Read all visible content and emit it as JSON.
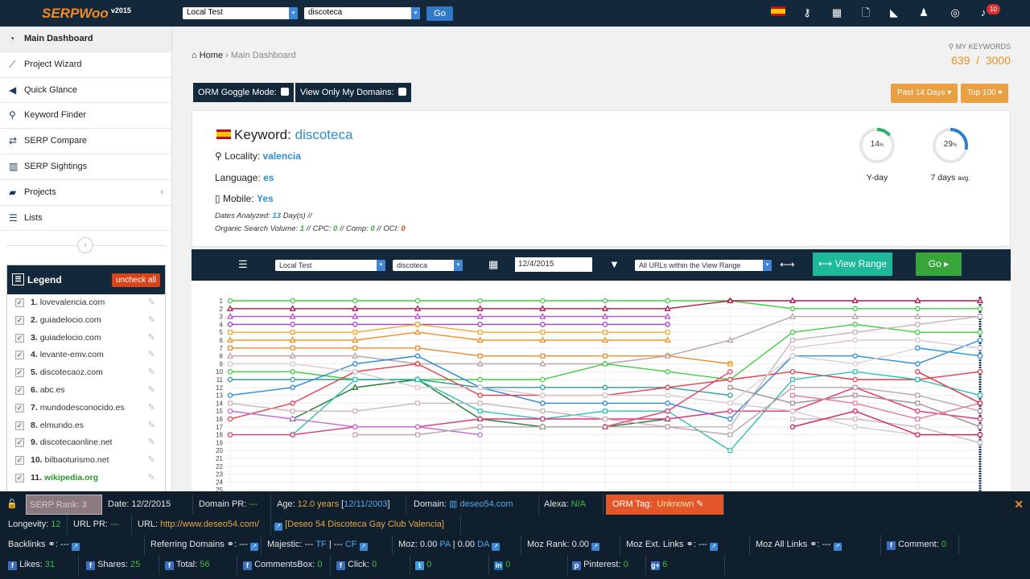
{
  "app": {
    "logo": "SERPWoo",
    "version": "v2015"
  },
  "topbar": {
    "project_select": "Local Test",
    "keyword_select": "discoteca",
    "go_label": "Go",
    "notifications_count": "10",
    "icons": [
      "spain-flag-icon",
      "key-icon",
      "table-icon",
      "pdf-icon",
      "area-chart-icon",
      "users-icon",
      "lifebuoy-icon",
      "bell-icon"
    ]
  },
  "sidebar": {
    "items": [
      {
        "label": "Main Dashboard",
        "icon": "dashboard-icon"
      },
      {
        "label": "Project Wizard",
        "icon": "magic-wand-icon"
      },
      {
        "label": "Quick Glance",
        "icon": "bullhorn-icon"
      },
      {
        "label": "Keyword Finder",
        "icon": "search-icon"
      },
      {
        "label": "SERP Compare",
        "icon": "exchange-icon"
      },
      {
        "label": "SERP Sightings",
        "icon": "bar-chart-icon"
      },
      {
        "label": "Projects",
        "icon": "folder-icon"
      },
      {
        "label": "Lists",
        "icon": "list-icon"
      }
    ]
  },
  "legend": {
    "title": "Legend",
    "uncheck_label": "uncheck all",
    "items": [
      {
        "num": "1.",
        "domain": "lovevalencia.com"
      },
      {
        "num": "2.",
        "domain": "guiadelocio.com"
      },
      {
        "num": "3.",
        "domain": "guiadelocio.com"
      },
      {
        "num": "4.",
        "domain": "levante-emv.com"
      },
      {
        "num": "5.",
        "domain": "discotecaoz.com"
      },
      {
        "num": "6.",
        "domain": "abc.es"
      },
      {
        "num": "7.",
        "domain": "mundodesconocido.es"
      },
      {
        "num": "8.",
        "domain": "elmundo.es"
      },
      {
        "num": "9.",
        "domain": "discotecaonline.net"
      },
      {
        "num": "10.",
        "domain": "bilbaoturismo.net"
      },
      {
        "num": "11.",
        "domain": "wikipedia.org"
      }
    ]
  },
  "breadcrumb": {
    "home": "Home",
    "sep": "›",
    "current": "Main Dashboard"
  },
  "my_keywords": {
    "label": "MY KEYWORDS",
    "used": "639",
    "sep": "/",
    "total": "3000"
  },
  "orm": {
    "goggle_label": "ORM Goggle Mode:",
    "domains_label": "View Only My Domains:"
  },
  "range_buttons": {
    "period": "Past 14 Days ▾",
    "top": "Top 100 ▾"
  },
  "keyword_panel": {
    "keyword_label": "Keyword:",
    "keyword": "discoteca",
    "locality_label": "Locality:",
    "locality": "valencia",
    "language_label": "Language:",
    "language": "es",
    "mobile_label": "Mobile:",
    "mobile": "Yes",
    "dates_prefix": "Dates Analyzed:",
    "dates_value": "13",
    "dates_suffix": "Day(s) //",
    "osv_prefix": "Organic Search Volume:",
    "osv": "1",
    "cpc_label": "// CPC:",
    "cpc": "0",
    "comp_label": "// Comp:",
    "comp": "0",
    "oci_label": "// OCI:",
    "oci": "0",
    "yday_value": "14",
    "yday_unit": "%",
    "yday_label": "Y-day",
    "week_value": "29",
    "week_unit": "%",
    "week_label": "7 days",
    "week_suffix": "avg."
  },
  "chart_toolbar": {
    "project": "Local Test",
    "keyword": "discoteca",
    "date": "12/4/2015",
    "url_filter": "All URLs within the View Range",
    "view_range_label": "View Range",
    "go_label": "Go"
  },
  "chart_data": {
    "type": "line",
    "y_tick_labels": [
      "1",
      "2",
      "3",
      "4",
      "5",
      "6",
      "7",
      "8",
      "9",
      "10",
      "11",
      "12",
      "13",
      "14",
      "15",
      "16",
      "17",
      "18",
      "19",
      "20",
      "21",
      "22",
      "23",
      "24",
      "25"
    ],
    "ylim": [
      1,
      25
    ],
    "y_inverted": true,
    "x_points": 13,
    "grid": true,
    "series": [
      {
        "color": "#3ecf3e",
        "marker": "circle",
        "values": [
          1,
          1,
          1,
          1,
          1,
          1,
          1,
          1,
          1,
          2,
          2,
          2,
          2
        ]
      },
      {
        "color": "#b2174f",
        "marker": "triangle",
        "values": [
          2,
          2,
          2,
          2,
          2,
          2,
          2,
          2,
          1,
          1,
          1,
          1,
          1
        ]
      },
      {
        "color": "#b94fd6",
        "marker": "triangle",
        "values": [
          3,
          3,
          3,
          3,
          3,
          3,
          3,
          3,
          null,
          null,
          null,
          null,
          null
        ]
      },
      {
        "color": "#a63cd0",
        "marker": "circle",
        "values": [
          4,
          4,
          4,
          4,
          4,
          4,
          4,
          4,
          null,
          null,
          null,
          null,
          null
        ]
      },
      {
        "color": "#f2a92b",
        "marker": "square",
        "values": [
          5,
          5,
          5,
          4,
          5,
          5,
          5,
          5,
          null,
          null,
          null,
          null,
          null
        ]
      },
      {
        "color": "#f0932a",
        "marker": "triangle",
        "values": [
          6,
          6,
          6,
          5,
          6,
          6,
          6,
          6,
          null,
          null,
          null,
          null,
          null
        ]
      },
      {
        "color": "#ea8a2a",
        "marker": "square",
        "values": [
          7,
          7,
          7,
          7,
          8,
          8,
          8,
          8,
          9,
          null,
          null,
          null,
          null
        ]
      },
      {
        "color": "#b8a2a6",
        "marker": "triangle",
        "values": [
          8,
          8,
          8,
          9,
          9,
          9,
          9,
          8,
          6,
          3,
          3,
          3,
          3
        ]
      },
      {
        "color": "#3ecf3e",
        "marker": "circle",
        "values": [
          10,
          10,
          11,
          11,
          11,
          11,
          9,
          10,
          11,
          5,
          4,
          5,
          5
        ]
      },
      {
        "color": "#2d9e9e",
        "marker": "circle",
        "values": [
          11,
          11,
          11,
          11,
          12,
          12,
          12,
          12,
          13,
          null,
          null,
          null,
          null
        ]
      },
      {
        "color": "#2d88d6",
        "marker": "circle",
        "values": [
          13,
          12,
          9,
          8,
          12,
          14,
          14,
          14,
          16,
          8,
          8,
          9,
          6
        ]
      },
      {
        "color": "#e83a4a",
        "marker": "circle",
        "values": [
          16,
          14,
          10,
          9,
          13,
          13,
          13,
          12,
          11,
          10,
          11,
          11,
          10
        ]
      },
      {
        "color": "#1d7a2e",
        "marker": "triangle",
        "values": [
          null,
          16,
          12,
          11,
          16,
          17,
          17,
          16,
          null,
          null,
          null,
          null,
          null
        ]
      },
      {
        "color": "#2fc0b0",
        "marker": "square",
        "values": [
          null,
          18,
          11,
          11,
          15,
          16,
          15,
          15,
          20,
          11,
          10,
          11,
          13
        ]
      },
      {
        "color": "#e0347a",
        "marker": "circle",
        "values": [
          18,
          18,
          17,
          17,
          16,
          16,
          16,
          16,
          15,
          15,
          12,
          15,
          16
        ]
      },
      {
        "color": "#c06ad8",
        "marker": "circle",
        "values": [
          15,
          16,
          17,
          17,
          18,
          null,
          null,
          null,
          null,
          null,
          null,
          null,
          null
        ]
      },
      {
        "color": "#d8c9cc",
        "marker": "square",
        "values": [
          9,
          9,
          10,
          12,
          12,
          13,
          13,
          13,
          14,
          15,
          17,
          18,
          18
        ]
      },
      {
        "color": "#c8b4b8",
        "marker": "square",
        "values": [
          14,
          15,
          15,
          14,
          14,
          15,
          16,
          17,
          17,
          6,
          5,
          4,
          3
        ]
      },
      {
        "color": "#bba3a8",
        "marker": "square",
        "values": [
          null,
          null,
          18,
          18,
          17,
          17,
          17,
          17,
          18,
          12,
          12,
          13,
          15
        ]
      },
      {
        "color": "#a48e92",
        "marker": "square",
        "values": [
          null,
          null,
          null,
          null,
          null,
          null,
          null,
          null,
          12,
          14,
          13,
          14,
          17
        ]
      },
      {
        "color": "#ddd0d2",
        "marker": "square",
        "values": [
          null,
          null,
          null,
          null,
          null,
          null,
          null,
          null,
          14,
          8,
          9,
          7,
          8
        ]
      },
      {
        "color": "#e07aa4",
        "marker": "square",
        "values": [
          null,
          null,
          null,
          null,
          null,
          null,
          null,
          null,
          null,
          13,
          14,
          16,
          14
        ]
      },
      {
        "color": "#c9b8bb",
        "marker": "square",
        "values": [
          null,
          null,
          null,
          null,
          null,
          null,
          null,
          null,
          null,
          16,
          16,
          17,
          19
        ]
      },
      {
        "color": "#dcc9cc",
        "marker": "square",
        "values": [
          null,
          null,
          null,
          null,
          null,
          null,
          null,
          null,
          null,
          7,
          6,
          6,
          7
        ]
      },
      {
        "color": "#e8426c",
        "marker": "circle",
        "values": [
          null,
          null,
          null,
          null,
          null,
          null,
          17,
          15,
          10,
          null,
          null,
          null,
          null
        ]
      },
      {
        "color": "#d71a5c",
        "marker": "circle",
        "values": [
          null,
          null,
          null,
          null,
          null,
          null,
          null,
          null,
          null,
          17,
          15,
          18,
          18
        ]
      },
      {
        "color": "#f2a92b",
        "marker": "triangle",
        "values": [
          null,
          null,
          null,
          null,
          null,
          null,
          null,
          null,
          9,
          null,
          null,
          null,
          null
        ]
      },
      {
        "color": "#e03040",
        "marker": "circle",
        "values": [
          null,
          null,
          null,
          null,
          null,
          null,
          null,
          null,
          null,
          null,
          null,
          10,
          14
        ]
      },
      {
        "color": "#2a9ae0",
        "marker": "circle",
        "values": [
          null,
          null,
          null,
          null,
          null,
          null,
          null,
          null,
          null,
          null,
          null,
          7,
          8
        ]
      }
    ],
    "highlight_column_index": 12
  },
  "footer": {
    "serp_rank_label": "SERP Rank:",
    "serp_rank": "3",
    "date_label": "Date:",
    "date": "12/2/2015",
    "domain_pr_label": "Domain PR:",
    "domain_pr": "---",
    "age_label": "Age:",
    "age_years": "12.0 years",
    "age_bracket_open": "[",
    "age_date": "12/11/2003",
    "age_bracket_close": "]",
    "domain_label": "Domain:",
    "domain": "deseo54.com",
    "alexa_label": "Alexa:",
    "alexa": "N/A",
    "orm_tag_label": "ORM Tag:",
    "orm_tag": "Unknown",
    "longevity_label": "Longevity:",
    "longevity": "12",
    "url_pr_label": "URL PR:",
    "url_pr": "---",
    "url_label": "URL:",
    "url": "http://www.deseo54.com/",
    "page_title_open": "[",
    "page_title": "Deseo 54 Discoteca Gay Club Valencia",
    "page_title_close": "]",
    "backlinks_label": "Backlinks",
    "backlinks": "---",
    "ref_domains_label": "Referring Domains",
    "ref_domains": "---",
    "majestic_label": "Majestic:",
    "majestic_a": "---",
    "majestic_tf": "TF",
    "majestic_sep": "|",
    "majestic_b": "---",
    "majestic_cf": "CF",
    "moz_label": "Moz:",
    "moz_pa_val": "0.00",
    "moz_pa": "PA",
    "moz_sep": "|",
    "moz_da_val": "0.00",
    "moz_da": "DA",
    "moz_rank_label": "Moz Rank:",
    "moz_rank": "0.00",
    "moz_ext_label": "Moz Ext. Links",
    "moz_ext": "---",
    "moz_all_label": "Moz All Links",
    "moz_all": "---",
    "comment_label": "Comment:",
    "comment": "0",
    "likes_label": "Likes:",
    "likes": "31",
    "shares_label": "Shares:",
    "shares": "25",
    "total_label": "Total:",
    "total": "56",
    "commentsbox_label": "CommentsBox:",
    "commentsbox": "0",
    "click_label": "Click:",
    "click": "0",
    "twitter": "0",
    "linkedin": "0",
    "pinterest_label": "Pinterest:",
    "pinterest": "0",
    "gplus": "6"
  }
}
